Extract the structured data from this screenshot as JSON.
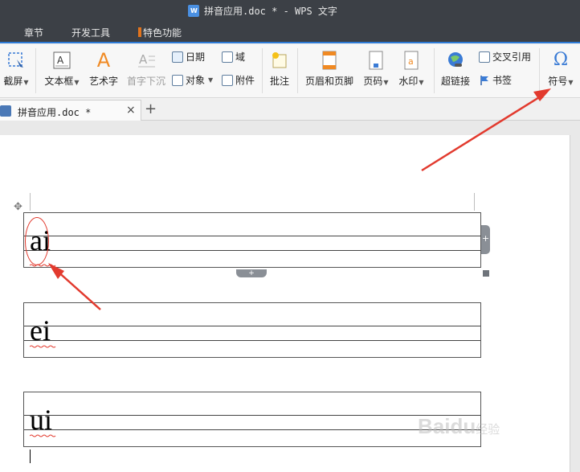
{
  "window": {
    "title": "拼音应用.doc * - WPS 文字"
  },
  "menu": {
    "items": [
      {
        "label": "章节"
      },
      {
        "label": "开发工具"
      },
      {
        "label": "特色功能"
      }
    ]
  },
  "toolbar": {
    "screenshot": "截屏",
    "textbox": "文本框",
    "wordart": "艺术字",
    "first_letter_sink": "首字下沉",
    "date": "日期",
    "object": "对象",
    "field": "域",
    "attachment": "附件",
    "comment": "批注",
    "header_footer": "页眉和页脚",
    "page_number": "页码",
    "watermark": "水印",
    "hyperlink": "超链接",
    "cross_reference": "交叉引用",
    "bookmark": "书签",
    "symbol": "符号",
    "symbol_glyph": "Ω",
    "wordart_glyph": "A"
  },
  "tabs": {
    "doc_tab": "拼音应用.doc *",
    "close_glyph": "×",
    "new_tab_glyph": "+"
  },
  "document": {
    "words": [
      "ai",
      "ei",
      "ui"
    ],
    "handle_plus": "+",
    "move_glyph": "✥"
  },
  "watermark": {
    "brand": "Baidu",
    "suffix": "经验"
  },
  "colors": {
    "accent_blue": "#2e7bd6",
    "annotation_red": "#e23a2e",
    "title_bar": "#3c4046"
  }
}
